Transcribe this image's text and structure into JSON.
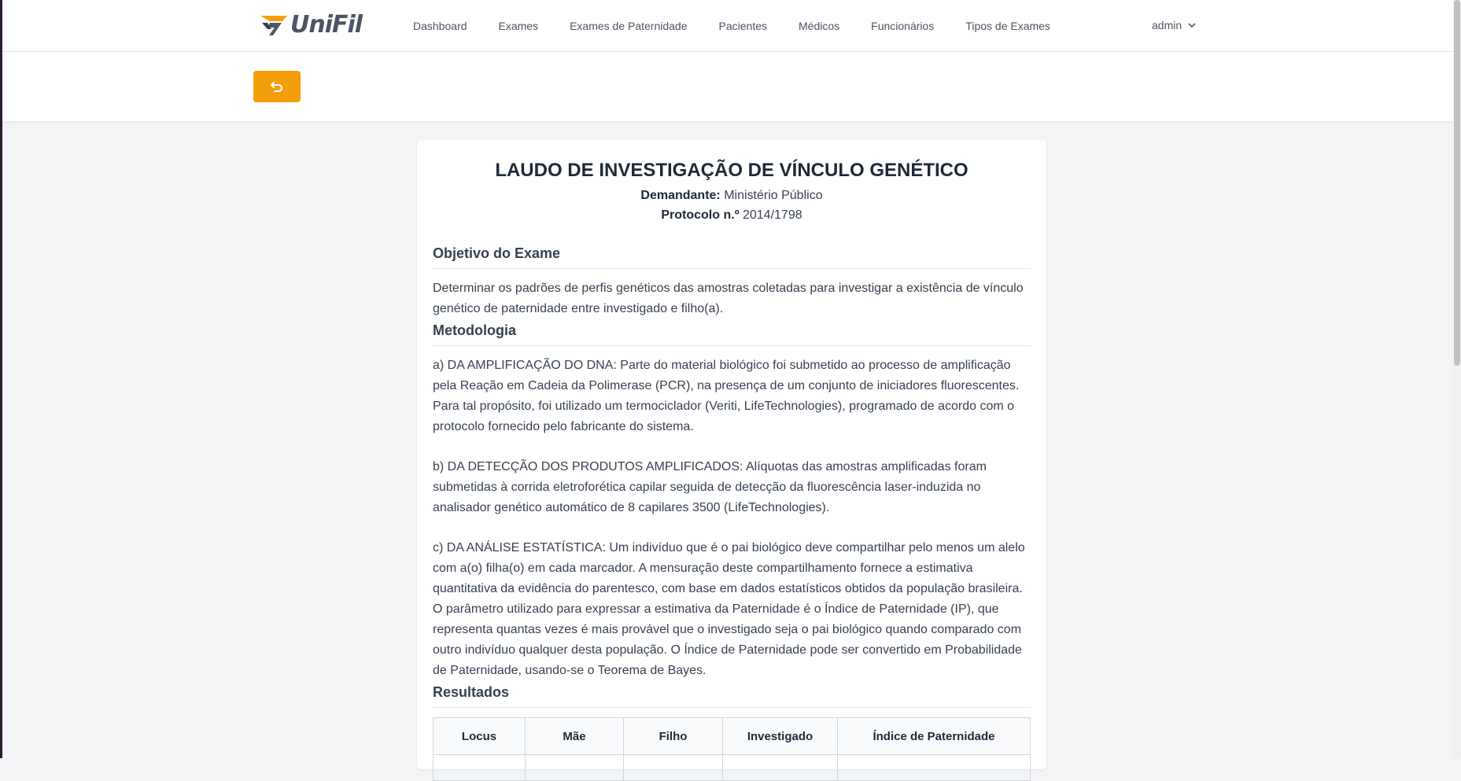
{
  "nav": {
    "brand": "UniFil",
    "items": [
      "Dashboard",
      "Exames",
      "Exames de Paternidade",
      "Pacientes",
      "Médicos",
      "Funcionários",
      "Tipos de Exames"
    ],
    "user": "admin"
  },
  "colors": {
    "accent": "#f59e0b",
    "background": "#f3f4f6"
  },
  "report": {
    "title": "LAUDO DE INVESTIGAÇÃO DE VÍNCULO GENÉTICO",
    "demandante_label": "Demandante:",
    "demandante": "Ministério Público",
    "protocolo_label": "Protocolo n.º",
    "protocolo": "2014/1798",
    "objetivo_title": "Objetivo do Exame",
    "objetivo_text": "Determinar os padrões de perfis genéticos das amostras coletadas para investigar a existência de vínculo genético de paternidade entre investigado e filho(a).",
    "metodologia_title": "Metodologia",
    "metodologia_a": "a) DA AMPLIFICAÇÃO DO DNA: Parte do material biológico foi submetido ao processo de amplificação pela Reação em Cadeia da Polimerase (PCR), na presença de um conjunto de iniciadores fluorescentes. Para tal propósito, foi utilizado um termociclador (Veriti, LifeTechnologies), programado de acordo com o protocolo fornecido pelo fabricante do sistema.",
    "metodologia_b": "b) DA DETECÇÃO DOS PRODUTOS AMPLIFICADOS: Alíquotas das amostras amplificadas foram submetidas à corrida eletroforética capilar seguida de detecção da fluorescência laser-induzida no analisador genético automático de 8 capilares 3500 (LifeTechnologies).",
    "metodologia_c": "c) DA ANÁLISE ESTATÍSTICA: Um indivíduo que é o pai biológico deve compartilhar pelo menos um alelo com a(o) filha(o) em cada marcador. A mensuração deste compartilhamento fornece a estimativa quantitativa da evidência do parentesco, com base em dados estatísticos obtidos da população brasileira. O parâmetro utilizado para expressar a estimativa da Paternidade é o Índice de Paternidade (IP), que representa quantas vezes é mais provável que o investigado seja o pai biológico quando comparado com outro indivíduo qualquer desta população. O Índice de Paternidade pode ser convertido em Probabilidade de Paternidade, usando-se o Teorema de Bayes.",
    "resultados_title": "Resultados",
    "table_headers": [
      "Locus",
      "Mãe",
      "Filho",
      "Investigado",
      "Índice de Paternidade"
    ]
  }
}
